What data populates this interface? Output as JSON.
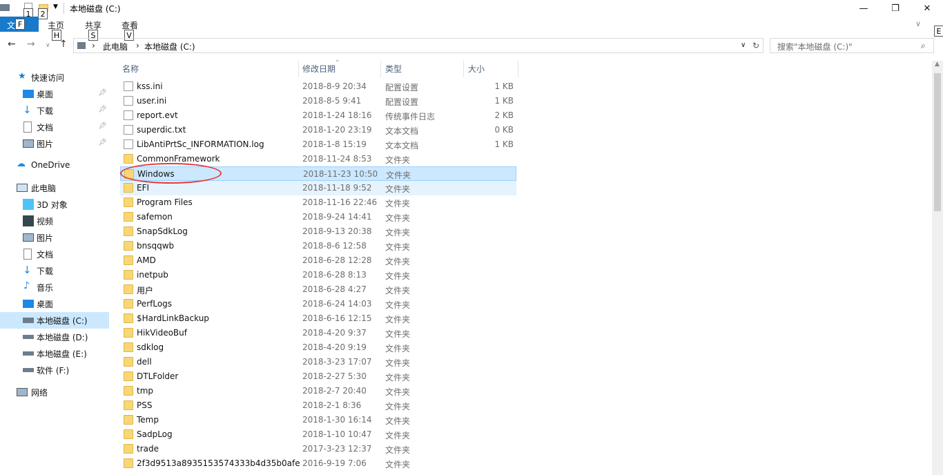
{
  "window": {
    "title": "本地磁盘 (C:)",
    "keytip_1": "1",
    "keytip_2": "2",
    "keytip_h": "H",
    "keytip_s": "S",
    "keytip_v": "V",
    "keytip_f": "F",
    "keytip_e": "E"
  },
  "ribbon": {
    "file_label": "文",
    "tabs": [
      "主页",
      "共享",
      "查看"
    ]
  },
  "address": {
    "crumbs": [
      "此电脑",
      "本地磁盘 (C:)"
    ],
    "search_placeholder": "搜索\"本地磁盘 (C:)\""
  },
  "sidebar": {
    "quick_access": "快速访问",
    "quick_items": [
      "桌面",
      "下载",
      "文档",
      "图片"
    ],
    "onedrive": "OneDrive",
    "this_pc": "此电脑",
    "pc_items": [
      "3D 对象",
      "视频",
      "图片",
      "文档",
      "下载",
      "音乐",
      "桌面",
      "本地磁盘 (C:)",
      "本地磁盘 (D:)",
      "本地磁盘 (E:)",
      "软件 (F:)"
    ],
    "network": "网络"
  },
  "columns": [
    "名称",
    "修改日期",
    "类型",
    "大小"
  ],
  "files": [
    {
      "name": "kss.ini",
      "date": "2018-8-9 20:34",
      "type": "配置设置",
      "size": "1 KB",
      "kind": "file"
    },
    {
      "name": "user.ini",
      "date": "2018-8-5 9:41",
      "type": "配置设置",
      "size": "1 KB",
      "kind": "file"
    },
    {
      "name": "report.evt",
      "date": "2018-1-24 18:16",
      "type": "传统事件日志",
      "size": "2 KB",
      "kind": "file"
    },
    {
      "name": "superdic.txt",
      "date": "2018-1-20 23:19",
      "type": "文本文档",
      "size": "0 KB",
      "kind": "file"
    },
    {
      "name": "LibAntiPrtSc_INFORMATION.log",
      "date": "2018-1-8 15:19",
      "type": "文本文档",
      "size": "1 KB",
      "kind": "file"
    },
    {
      "name": "CommonFramework",
      "date": "2018-11-24 8:53",
      "type": "文件夹",
      "size": "",
      "kind": "folder"
    },
    {
      "name": "Windows",
      "date": "2018-11-23 10:50",
      "type": "文件夹",
      "size": "",
      "kind": "folder"
    },
    {
      "name": "EFI",
      "date": "2018-11-18 9:52",
      "type": "文件夹",
      "size": "",
      "kind": "folder"
    },
    {
      "name": "Program Files",
      "date": "2018-11-16 22:46",
      "type": "文件夹",
      "size": "",
      "kind": "folder"
    },
    {
      "name": "safemon",
      "date": "2018-9-24 14:41",
      "type": "文件夹",
      "size": "",
      "kind": "folder"
    },
    {
      "name": "SnapSdkLog",
      "date": "2018-9-13 20:38",
      "type": "文件夹",
      "size": "",
      "kind": "folder"
    },
    {
      "name": "bnsqqwb",
      "date": "2018-8-6 12:58",
      "type": "文件夹",
      "size": "",
      "kind": "folder"
    },
    {
      "name": "AMD",
      "date": "2018-6-28 12:28",
      "type": "文件夹",
      "size": "",
      "kind": "folder"
    },
    {
      "name": "inetpub",
      "date": "2018-6-28 8:13",
      "type": "文件夹",
      "size": "",
      "kind": "folder"
    },
    {
      "name": "用户",
      "date": "2018-6-28 4:27",
      "type": "文件夹",
      "size": "",
      "kind": "folder"
    },
    {
      "name": "PerfLogs",
      "date": "2018-6-24 14:03",
      "type": "文件夹",
      "size": "",
      "kind": "folder"
    },
    {
      "name": "$HardLinkBackup",
      "date": "2018-6-16 12:15",
      "type": "文件夹",
      "size": "",
      "kind": "folder"
    },
    {
      "name": "HikVideoBuf",
      "date": "2018-4-20 9:37",
      "type": "文件夹",
      "size": "",
      "kind": "folder"
    },
    {
      "name": "sdklog",
      "date": "2018-4-20 9:19",
      "type": "文件夹",
      "size": "",
      "kind": "folder"
    },
    {
      "name": "dell",
      "date": "2018-3-23 17:07",
      "type": "文件夹",
      "size": "",
      "kind": "folder"
    },
    {
      "name": "DTLFolder",
      "date": "2018-2-27 5:30",
      "type": "文件夹",
      "size": "",
      "kind": "folder"
    },
    {
      "name": "tmp",
      "date": "2018-2-7 20:40",
      "type": "文件夹",
      "size": "",
      "kind": "folder"
    },
    {
      "name": "PSS",
      "date": "2018-2-1 8:36",
      "type": "文件夹",
      "size": "",
      "kind": "folder"
    },
    {
      "name": "Temp",
      "date": "2018-1-30 16:14",
      "type": "文件夹",
      "size": "",
      "kind": "folder"
    },
    {
      "name": "SadpLog",
      "date": "2018-1-10 10:47",
      "type": "文件夹",
      "size": "",
      "kind": "folder"
    },
    {
      "name": "trade",
      "date": "2017-3-23 12:37",
      "type": "文件夹",
      "size": "",
      "kind": "folder"
    },
    {
      "name": "2f3d9513a8935153574333b4d35b0afe",
      "date": "2016-9-19 7:06",
      "type": "文件夹",
      "size": "",
      "kind": "folder"
    }
  ],
  "colors": {
    "accent": "#1979ca",
    "selection": "#cce8ff",
    "annotation": "#e53935"
  }
}
